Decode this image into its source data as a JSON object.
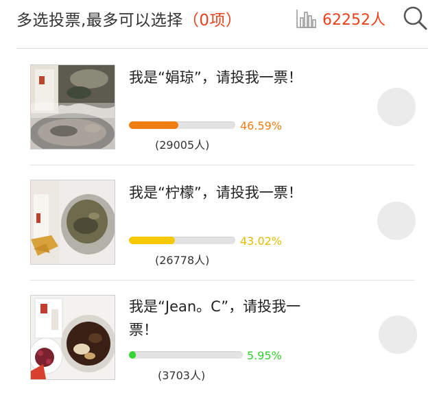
{
  "header": {
    "title": "多选投票,最多可以选择",
    "selected_count": "（0项）",
    "participants": "62252人",
    "chart_icon": "bar-chart-icon",
    "search_icon": "search-icon",
    "accent_color": "#e8421c"
  },
  "options": [
    {
      "text": "我是“娟琼”，请投我一票！",
      "percent": "46.59%",
      "fraction": 0.4659,
      "votes": "(29005人)",
      "color": "#f07d13"
    },
    {
      "text": "我是“柠檬”，请投我一票！",
      "percent": "43.02%",
      "fraction": 0.4302,
      "votes": "(26778人)",
      "color": "#f5c800"
    },
    {
      "text": "我是“Jean。C”，请投我一票！",
      "percent": "5.95%",
      "fraction": 0.0595,
      "votes": "(3703人)",
      "color": "#33d633"
    }
  ]
}
